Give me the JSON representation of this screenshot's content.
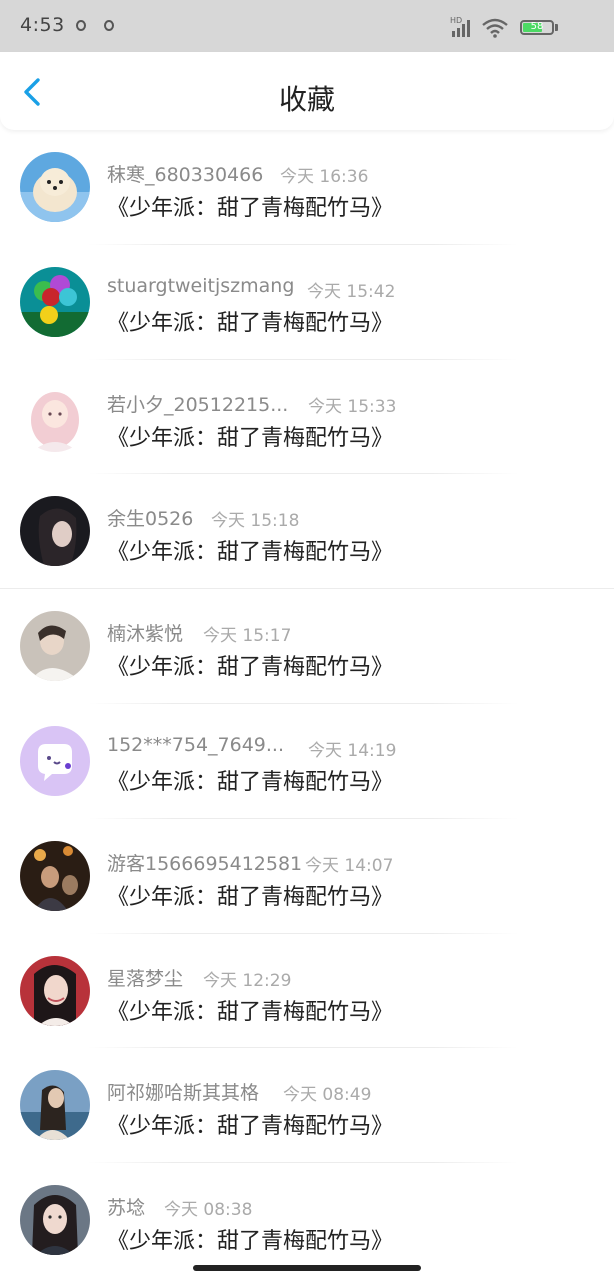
{
  "status_bar": {
    "time": "4:53",
    "battery": "58",
    "network_label": "HD"
  },
  "header": {
    "title": "收藏"
  },
  "items": [
    {
      "name": "秣寒_680330466",
      "time": "今天 16:36",
      "title": "《少年派：甜了青梅配竹马》"
    },
    {
      "name": "stuargtweitjszmang",
      "time": "今天 15:42",
      "title": "《少年派：甜了青梅配竹马》"
    },
    {
      "name": "若小夕_20512215...",
      "time": "今天 15:33",
      "title": "《少年派：甜了青梅配竹马》"
    },
    {
      "name": "余生0526",
      "time": "今天 15:18",
      "title": "《少年派：甜了青梅配竹马》"
    },
    {
      "name": "楠沐紫悦",
      "time": "今天 15:17",
      "title": "《少年派：甜了青梅配竹马》"
    },
    {
      "name": "152***754_7649...",
      "time": "今天 14:19",
      "title": "《少年派：甜了青梅配竹马》"
    },
    {
      "name": "游客1566695412581",
      "time": "今天 14:07",
      "title": "《少年派：甜了青梅配竹马》"
    },
    {
      "name": "星落梦尘",
      "time": "今天 12:29",
      "title": "《少年派：甜了青梅配竹马》"
    },
    {
      "name": "阿祁娜哈斯其其格",
      "time": "今天 08:49",
      "title": "《少年派：甜了青梅配竹马》"
    },
    {
      "name": "苏埝",
      "time": "今天 08:38",
      "title": "《少年派：甜了青梅配竹马》"
    }
  ],
  "colors": {
    "accent": "#1aa0e6",
    "status_bar_bg": "#d7d7d7",
    "battery_fill": "#4cd964"
  },
  "icons": {
    "back": "chevron-left-icon",
    "wifi": "wifi-icon",
    "signal": "signal-icon",
    "battery": "battery-icon"
  }
}
